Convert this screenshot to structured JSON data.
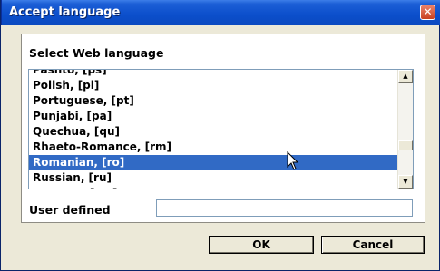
{
  "window": {
    "title": "Accept language",
    "close_symbol": "✕"
  },
  "panel": {
    "heading": "Select Web language"
  },
  "languages": [
    "Pashto, [ps]",
    "Polish, [pl]",
    "Portuguese, [pt]",
    "Punjabi, [pa]",
    "Quechua, [qu]",
    "Rhaeto-Romance, [rm]",
    "Romanian, [ro]",
    "Russian, [ru]",
    "Samoan, [sm]"
  ],
  "selected_language": "Romanian, [ro]",
  "user_defined": {
    "label": "User defined",
    "value": ""
  },
  "buttons": {
    "ok": "OK",
    "cancel": "Cancel"
  },
  "icons": {
    "scroll_up": "triangle-up-icon",
    "scroll_down": "triangle-down-icon",
    "cursor": "arrow-cursor-icon"
  },
  "colors": {
    "titlebar": "#0b4ecb",
    "selection": "#316ac5",
    "window_bg": "#ece9d8"
  }
}
